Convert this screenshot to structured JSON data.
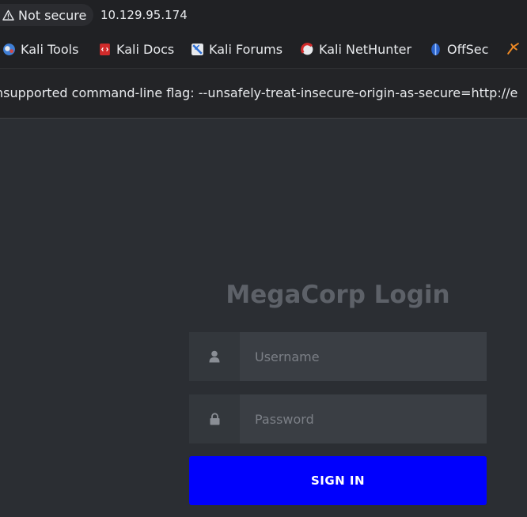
{
  "browser": {
    "security_label": "Not secure",
    "url": "10.129.95.174"
  },
  "bookmarks": [
    {
      "label": "Kali Tools",
      "icon": "kali-tools-icon"
    },
    {
      "label": "Kali Docs",
      "icon": "kali-docs-icon"
    },
    {
      "label": "Kali Forums",
      "icon": "kali-forums-icon"
    },
    {
      "label": "Kali NetHunter",
      "icon": "kali-nethunter-icon"
    },
    {
      "label": "OffSec",
      "icon": "offsec-icon"
    },
    {
      "label": "",
      "icon": "exploit-db-icon"
    }
  ],
  "infobar": {
    "message": "nsupported command-line flag: --unsafely-treat-insecure-origin-as-secure=http://e"
  },
  "login": {
    "title": "MegaCorp Login",
    "username_placeholder": "Username",
    "password_placeholder": "Password",
    "signin_label": "SIGN IN"
  },
  "colors": {
    "signin_bg": "#0000fd",
    "page_bg": "#2b2e33",
    "title": "#5d6168"
  }
}
